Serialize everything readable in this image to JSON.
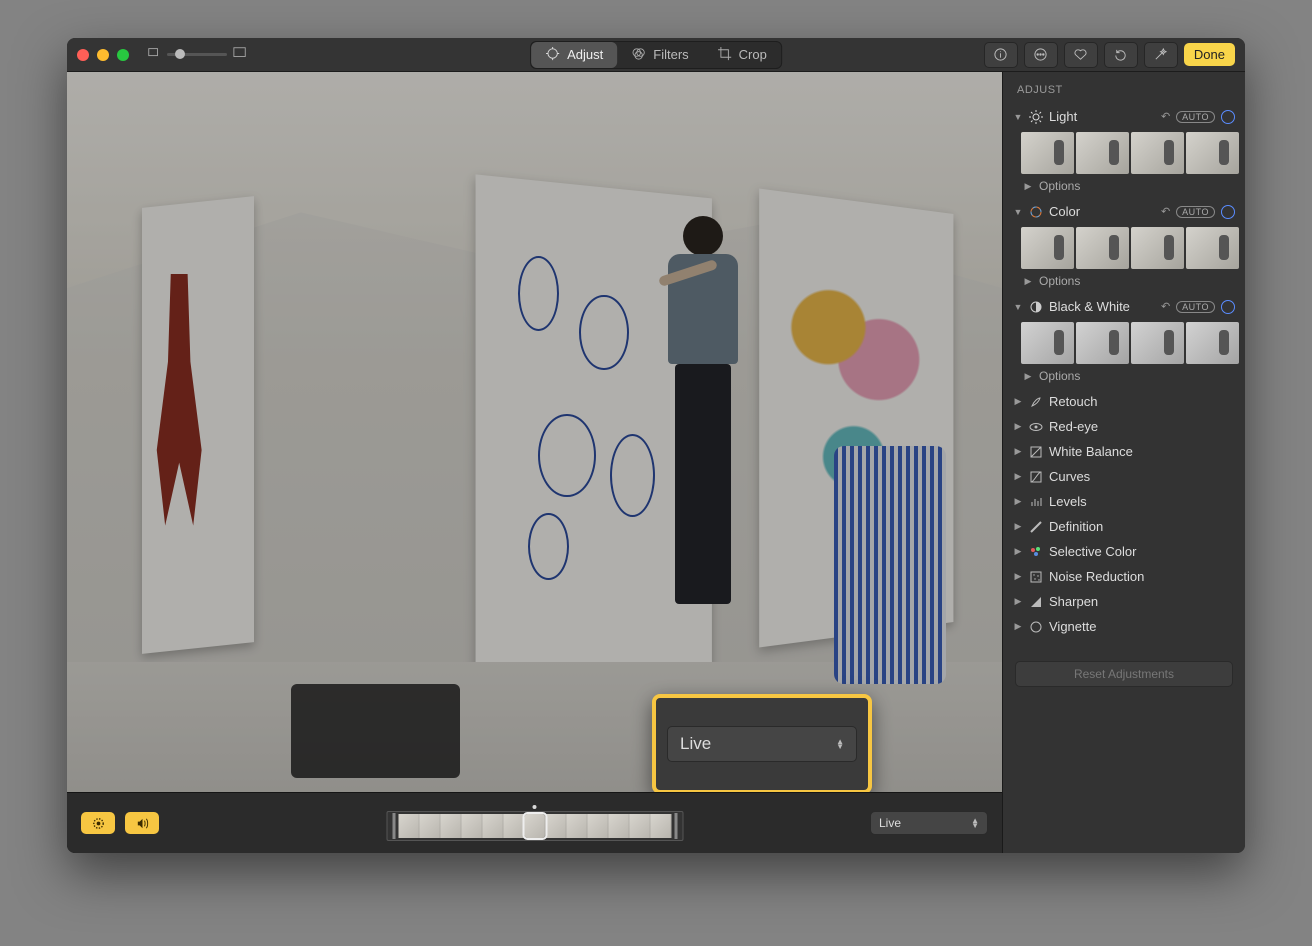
{
  "toolbar": {
    "segments": {
      "adjust": "Adjust",
      "filters": "Filters",
      "crop": "Crop"
    },
    "done": "Done"
  },
  "sidebar": {
    "title": "ADJUST",
    "auto": "AUTO",
    "sections": {
      "light": {
        "label": "Light",
        "options": "Options"
      },
      "color": {
        "label": "Color",
        "options": "Options"
      },
      "bw": {
        "label": "Black & White",
        "options": "Options"
      },
      "retouch": {
        "label": "Retouch"
      },
      "redeye": {
        "label": "Red-eye"
      },
      "wb": {
        "label": "White Balance"
      },
      "curves": {
        "label": "Curves"
      },
      "levels": {
        "label": "Levels"
      },
      "definition": {
        "label": "Definition"
      },
      "selcolor": {
        "label": "Selective Color"
      },
      "noise": {
        "label": "Noise Reduction"
      },
      "sharpen": {
        "label": "Sharpen"
      },
      "vignette": {
        "label": "Vignette"
      }
    },
    "reset": "Reset Adjustments"
  },
  "bottom": {
    "dropdown_value": "Live",
    "filmstrip_frame_count": 13,
    "selected_frame_index": 6
  },
  "callout": {
    "value": "Live"
  }
}
